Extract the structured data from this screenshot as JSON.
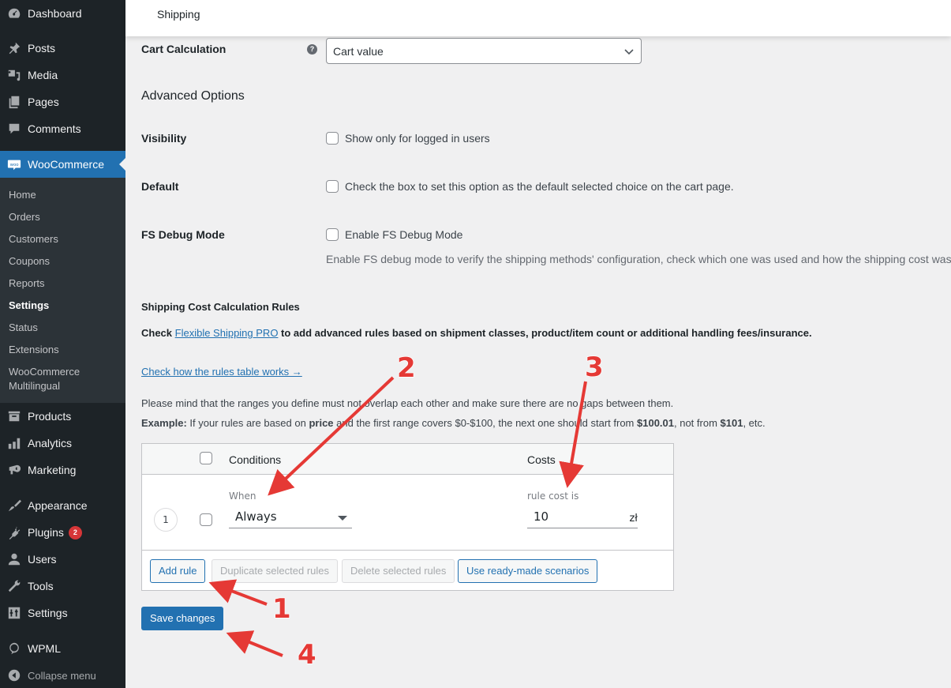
{
  "sidebar": {
    "top_items": [
      {
        "label": "Dashboard",
        "icon": "dashboard-icon"
      },
      {
        "label": "Posts",
        "icon": "pin-icon"
      },
      {
        "label": "Media",
        "icon": "media-icon"
      },
      {
        "label": "Pages",
        "icon": "pages-icon"
      },
      {
        "label": "Comments",
        "icon": "comment-icon"
      },
      {
        "label": "WooCommerce",
        "icon": "woo-icon",
        "active": true
      }
    ],
    "submenu": [
      {
        "label": "Home"
      },
      {
        "label": "Orders"
      },
      {
        "label": "Customers"
      },
      {
        "label": "Coupons"
      },
      {
        "label": "Reports"
      },
      {
        "label": "Settings",
        "current": true
      },
      {
        "label": "Status"
      },
      {
        "label": "Extensions"
      },
      {
        "label": "WooCommerce Multilingual"
      }
    ],
    "bottom_items": [
      {
        "label": "Products",
        "icon": "products-icon"
      },
      {
        "label": "Analytics",
        "icon": "analytics-icon"
      },
      {
        "label": "Marketing",
        "icon": "megaphone-icon"
      },
      {
        "label": "Appearance",
        "icon": "brush-icon"
      },
      {
        "label": "Plugins",
        "icon": "plug-icon",
        "badge": "2"
      },
      {
        "label": "Users",
        "icon": "user-icon"
      },
      {
        "label": "Tools",
        "icon": "wrench-icon"
      },
      {
        "label": "Settings",
        "icon": "settings-icon"
      },
      {
        "label": "WPML",
        "icon": "wpml-icon"
      },
      {
        "label": "Collapse menu",
        "icon": "collapse-icon"
      }
    ]
  },
  "topbar": {
    "title": "Shipping"
  },
  "form": {
    "cart_calculation": {
      "label": "Cart Calculation",
      "help": "?",
      "value": "Cart value"
    },
    "advanced_title": "Advanced Options",
    "visibility": {
      "label": "Visibility",
      "checkbox_label": "Show only for logged in users",
      "checked": false
    },
    "default": {
      "label": "Default",
      "checkbox_label": "Check the box to set this option as the default selected choice on the cart page.",
      "checked": false
    },
    "debug": {
      "label": "FS Debug Mode",
      "checkbox_label": "Enable FS Debug Mode",
      "checked": false,
      "description": "Enable FS debug mode to verify the shipping methods' configuration, check which one was used and how the shipping cost was"
    }
  },
  "rules": {
    "title": "Shipping Cost Calculation Rules",
    "pro_text_before": "Check ",
    "pro_link": "Flexible Shipping PRO",
    "pro_text_after": " to add advanced rules based on shipment classes, product/item count or additional handling fees/insurance.",
    "how_link": "Check how the rules table works →",
    "note": "Please mind that the ranges you define must not overlap each other and make sure there are no gaps between them.",
    "example_label": "Example:",
    "example_t1": " If your rules are based on ",
    "example_b1": "price",
    "example_t2": " and the first range covers $0-$100, the next one should start from ",
    "example_b2": "$100.01",
    "example_t3": ", not from ",
    "example_b3": "$101",
    "example_t4": ", etc.",
    "table": {
      "headers": {
        "conditions": "Conditions",
        "costs": "Costs"
      },
      "rows": [
        {
          "number": "1",
          "when_label": "When",
          "when_value": "Always",
          "cost_label": "rule cost is",
          "cost_value": "10",
          "currency": "zł"
        }
      ],
      "buttons": {
        "add": "Add rule",
        "duplicate": "Duplicate selected rules",
        "delete": "Delete selected rules",
        "scenarios": "Use ready-made scenarios"
      }
    },
    "save": "Save changes"
  },
  "annotations": [
    "1",
    "2",
    "3",
    "4"
  ]
}
